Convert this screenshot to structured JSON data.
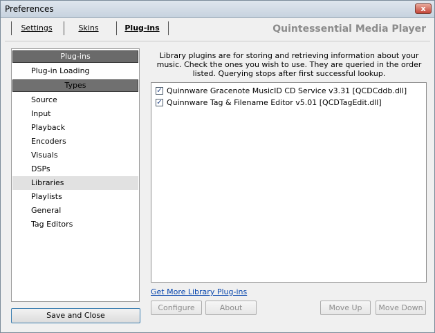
{
  "window": {
    "title": "Preferences",
    "close_glyph": "x"
  },
  "tabs": [
    {
      "label": "Settings"
    },
    {
      "label": "Skins"
    },
    {
      "label": "Plug-ins"
    }
  ],
  "app_name": "Quintessential Media Player",
  "sidebar": {
    "header_plugins": "Plug-ins",
    "header_types": "Types",
    "items": [
      {
        "label": "Plug-in Loading"
      },
      {
        "label": "Source"
      },
      {
        "label": "Input"
      },
      {
        "label": "Playback"
      },
      {
        "label": "Encoders"
      },
      {
        "label": "Visuals"
      },
      {
        "label": "DSPs"
      },
      {
        "label": "Libraries"
      },
      {
        "label": "Playlists"
      },
      {
        "label": "General"
      },
      {
        "label": "Tag Editors"
      }
    ],
    "selected": "Libraries"
  },
  "save_close_label": "Save and Close",
  "description": "Library plugins are for storing and retrieving information about your music. Check the ones you wish to use. They are queried in the order listed. Querying stops after first successful lookup.",
  "plugins": [
    {
      "label": "Quinnware Gracenote MusicID CD Service v3.31  [QCDCddb.dll]",
      "checked": true
    },
    {
      "label": "Quinnware Tag & Filename Editor v5.01  [QCDTagEdit.dll]",
      "checked": true
    }
  ],
  "get_more_link": "Get More Library Plug-ins",
  "buttons": {
    "configure": "Configure",
    "about": "About",
    "move_up": "Move Up",
    "move_down": "Move Down"
  },
  "colors": {
    "selected_row": "#e1e1e1",
    "link": "#0645ad",
    "disabled_text": "#8d8d8d"
  }
}
